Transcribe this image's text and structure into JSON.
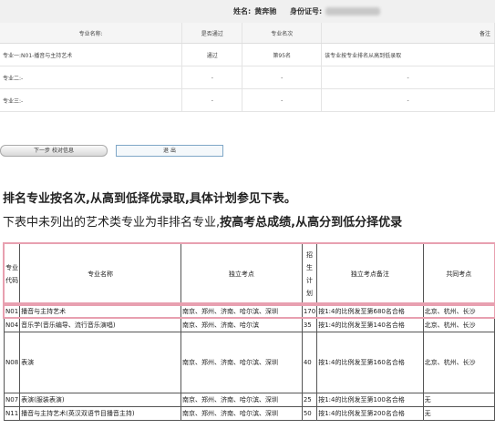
{
  "identity": {
    "name_label": "姓名:",
    "name_value": "黄奔驰",
    "id_label": "身份证号:"
  },
  "result_table": {
    "headers": [
      "专业名称:",
      "是否通过",
      "专业名次",
      "备注"
    ],
    "rows": [
      {
        "name": "专业一:N01-播音与主持艺术",
        "pass": "通过",
        "rank": "第95名",
        "note": "该专业按专业排名从高到低录取"
      },
      {
        "name": "专业二:-",
        "pass": "-",
        "rank": "-",
        "note": "-"
      },
      {
        "name": "专业三:-",
        "pass": "-",
        "rank": "-",
        "note": "-"
      }
    ]
  },
  "buttons": {
    "next": "下一步 校对信息",
    "exit": "退 出"
  },
  "paragraphs": {
    "line1": "排名专业按名次,从高到低择优录取,具体计划参见下表。",
    "line2_a": "下表中未列出的艺术类专业为非排名专业,",
    "line2_b": "按高考总成绩,从高分到低分择优录"
  },
  "plan_table": {
    "headers": {
      "code": "专业代码",
      "name": "专业名称",
      "sites": "独立考点",
      "quota": "招生计划",
      "sites_note": "独立考点备注",
      "common": "共同考点"
    },
    "rows": [
      {
        "code": "N01",
        "name": "播音与主持艺术",
        "sites": "南京、郑州、济南、哈尔滨、深圳",
        "quota": "170",
        "note": "按1:4的比例发至第680名合格",
        "common": "北京、杭州、长沙"
      },
      {
        "code": "N04",
        "name": "音乐学(音乐编导、流行音乐演唱)",
        "sites": "南京、郑州、济南、哈尔滨",
        "quota": "35",
        "note": "按1:4的比例发至第140名合格",
        "common": "北京、杭州、长沙"
      },
      {
        "code": "N08",
        "name": "表演",
        "sites": "南京、郑州、济南、哈尔滨、深圳",
        "quota": "40",
        "note": "按1:4的比例发至第160名合格",
        "common": "北京、杭州、长沙"
      },
      {
        "code": "N07",
        "name": "表演(服装表演)",
        "sites": "南京、郑州、济南、哈尔滨、深圳",
        "quota": "25",
        "note": "按1:4的比例发至第100名合格",
        "common": "无"
      },
      {
        "code": "N11",
        "name": "播音与主持艺术(英汉双语节目播音主持)",
        "sites": "南京、郑州、济南、哈尔滨、深圳",
        "quota": "50",
        "note": "按1:4的比例发至第200名合格",
        "common": "无"
      }
    ]
  }
}
